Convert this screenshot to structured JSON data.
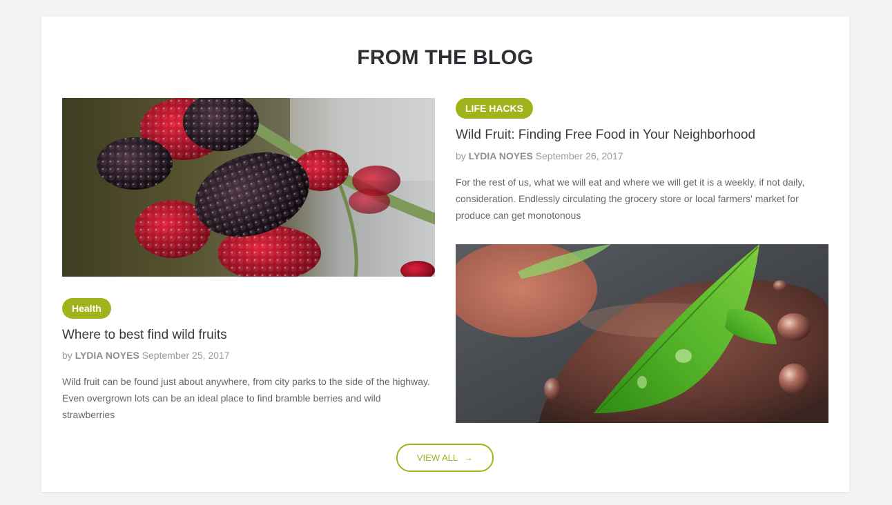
{
  "section": {
    "title": "FROM THE BLOG"
  },
  "posts": [
    {
      "tag": "Health",
      "title": "Where to best find wild fruits",
      "by": "by",
      "author": "LYDIA NOYES",
      "date": "September 25, 2017",
      "excerpt": "Wild fruit can be found just about anywhere, from city parks to the side of the highway. Even overgrown lots can be an ideal place to find bramble berries and wild strawberries",
      "image": "mulberries-photo"
    },
    {
      "tag": "LIFE HACKS",
      "title": "Wild Fruit: Finding Free Food in Your Neighborhood",
      "by": "by",
      "author": "LYDIA NOYES",
      "date": "September 26, 2017",
      "excerpt": "For the rest of us, what we will eat and where we will get it is a weekly, if not daily, consideration. Endlessly circulating the grocery store or local farmers' market for produce can get monotonous",
      "image": "leaves-on-stone-photo"
    }
  ],
  "view_all": {
    "label": "VIEW ALL",
    "icon": "→"
  },
  "colors": {
    "accent": "#a1b31b",
    "title": "#2c2f33",
    "text": "#666666",
    "meta": "#9a9a9a",
    "background": "#f3f3f3",
    "card": "#ffffff"
  }
}
